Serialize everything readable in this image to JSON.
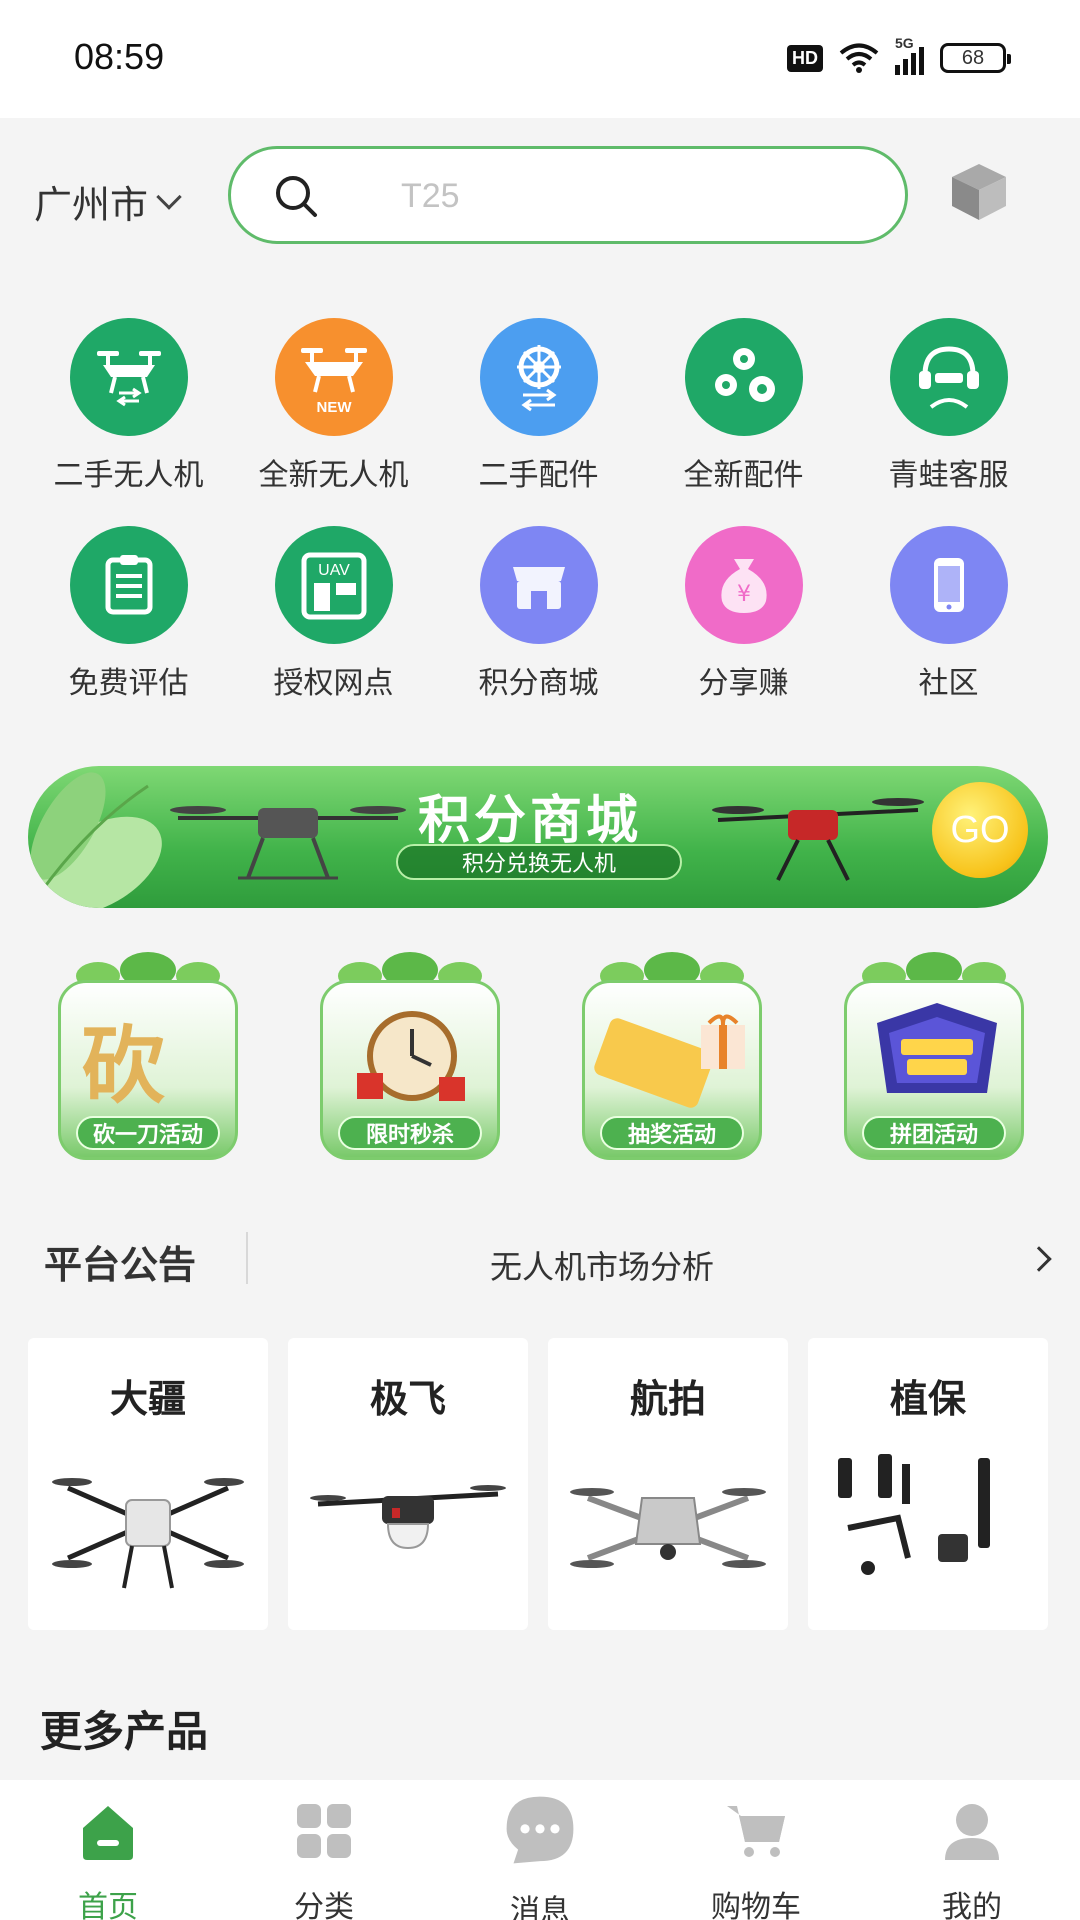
{
  "status_bar": {
    "time": "08:59",
    "hd_badge": "HD",
    "network": "5G",
    "battery": "68"
  },
  "header": {
    "city": "广州市",
    "search_placeholder": "T25"
  },
  "menu": [
    {
      "label": "二手无人机",
      "icon": "used-drone-icon",
      "color": "#1fa867"
    },
    {
      "label": "全新无人机",
      "icon": "new-drone-icon",
      "color": "#f7902e",
      "badge": "NEW"
    },
    {
      "label": "二手配件",
      "icon": "used-parts-icon",
      "color": "#4c9ef0"
    },
    {
      "label": "全新配件",
      "icon": "new-parts-icon",
      "color": "#1fa867"
    },
    {
      "label": "青蛙客服",
      "icon": "customer-service-icon",
      "color": "#1fa867"
    },
    {
      "label": "免费评估",
      "icon": "clipboard-icon",
      "color": "#1fa867"
    },
    {
      "label": "授权网点",
      "icon": "authorized-store-icon",
      "color": "#1fa867",
      "badge": "UAV"
    },
    {
      "label": "积分商城",
      "icon": "store-icon",
      "color": "#7e86f3"
    },
    {
      "label": "分享赚",
      "icon": "money-bag-icon",
      "color": "#f06bc8"
    },
    {
      "label": "社区",
      "icon": "phone-icon",
      "color": "#7e86f3"
    }
  ],
  "banner": {
    "title": "积分商城",
    "subtitle": "积分兑换无人机",
    "go_label": "GO"
  },
  "promos": [
    {
      "label": "砍一刀活动",
      "icon": "bargain-icon"
    },
    {
      "label": "限时秒杀",
      "icon": "alarm-clock-icon"
    },
    {
      "label": "抽奖活动",
      "icon": "ticket-icon"
    },
    {
      "label": "拼团活动",
      "icon": "group-buy-icon"
    }
  ],
  "notice": {
    "title": "平台公告",
    "text": "无人机市场分析"
  },
  "brands": [
    {
      "name": "大疆",
      "icon": "ag-drone-icon"
    },
    {
      "name": "极飞",
      "icon": "spray-drone-icon"
    },
    {
      "name": "航拍",
      "icon": "camera-drone-icon"
    },
    {
      "name": "植保",
      "icon": "gimbal-accessories-icon"
    }
  ],
  "more_products_title": "更多产品",
  "tabbar": [
    {
      "label": "首页",
      "icon": "home-icon",
      "active": true
    },
    {
      "label": "分类",
      "icon": "grid-icon",
      "active": false
    },
    {
      "label": "消息",
      "icon": "message-icon",
      "active": false
    },
    {
      "label": "购物车",
      "icon": "cart-icon",
      "active": false
    },
    {
      "label": "我的",
      "icon": "profile-icon",
      "active": false
    }
  ],
  "colors": {
    "brand_green": "#3da24a",
    "search_border": "#5fbb6a",
    "background": "#f4f4f4"
  }
}
